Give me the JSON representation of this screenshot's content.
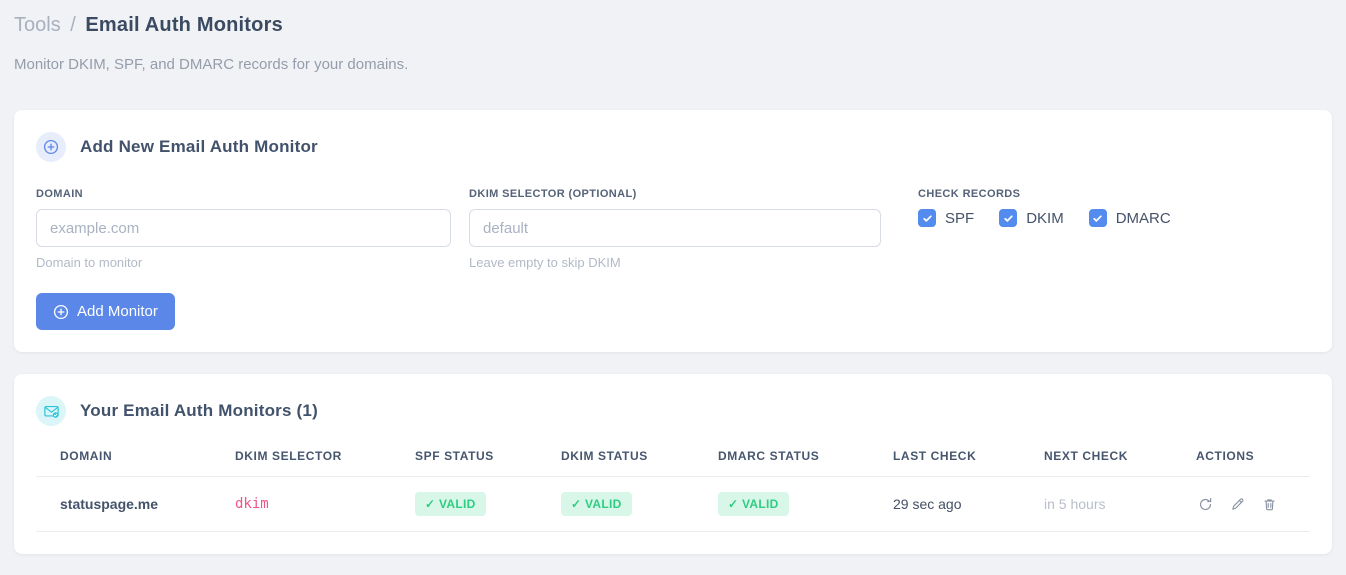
{
  "page": {
    "breadcrumb_section": "Tools",
    "breadcrumb_separator": "/",
    "title": "Email Auth Monitors",
    "subtitle": "Monitor DKIM, SPF, and DMARC records for your domains."
  },
  "add_card": {
    "title": "Add New Email Auth Monitor",
    "header_icon": "plus-circle-icon",
    "domain_field": {
      "label": "DOMAIN",
      "placeholder": "example.com",
      "value": "",
      "helper": "Domain to monitor"
    },
    "dkim_field": {
      "label": "DKIM SELECTOR (OPTIONAL)",
      "placeholder": "default",
      "value": "",
      "helper": "Leave empty to skip DKIM"
    },
    "check_records": {
      "label": "CHECK RECORDS",
      "options": [
        {
          "label": "SPF",
          "checked": true
        },
        {
          "label": "DKIM",
          "checked": true
        },
        {
          "label": "DMARC",
          "checked": true
        }
      ]
    },
    "submit_label": "Add Monitor",
    "submit_icon": "plus-circle-icon"
  },
  "monitors_card": {
    "title": "Your Email Auth Monitors (1)",
    "header_icon": "envelope-check-icon",
    "headers": [
      "DOMAIN",
      "DKIM SELECTOR",
      "SPF STATUS",
      "DKIM STATUS",
      "DMARC STATUS",
      "LAST CHECK",
      "NEXT CHECK",
      "ACTIONS"
    ],
    "rows": [
      {
        "domain": "statuspage.me",
        "dkim_selector": "dkim",
        "spf_status": "✓ VALID",
        "dkim_status": "✓ VALID",
        "dmarc_status": "✓ VALID",
        "last_check": "29 sec ago",
        "next_check": "in 5 hours",
        "action_icons": [
          "refresh-icon",
          "edit-pencil-icon",
          "trash-icon"
        ]
      }
    ]
  },
  "colors": {
    "accent_blue": "#5b87e8",
    "checkbox_blue": "#548bee",
    "valid_badge_bg": "#d9f7e8",
    "valid_badge_text": "#2ecd83",
    "dkim_selector_pink": "#f0548c",
    "card_icon_blue": "#5b87e8",
    "card_icon_cyan": "#2cc5d6",
    "page_bg": "#f1f2f5"
  }
}
